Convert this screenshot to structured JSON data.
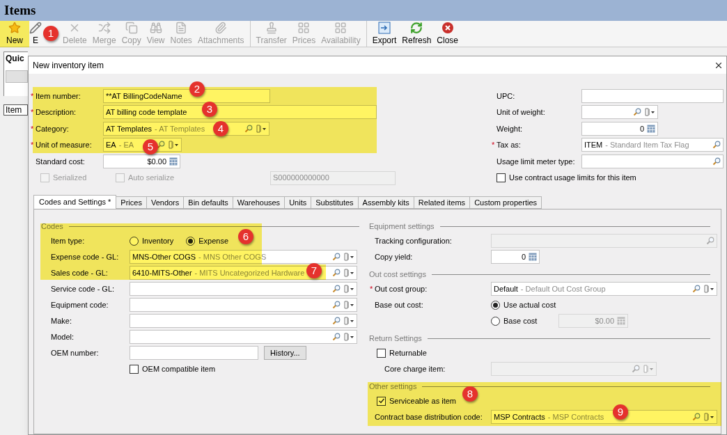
{
  "window": {
    "title": "Items"
  },
  "toolbar_groups": [
    {
      "buttons": [
        {
          "label": "New",
          "disabled": false
        },
        {
          "label": "E",
          "disabled": false
        },
        {
          "label": "Delete",
          "disabled": true
        },
        {
          "label": "Merge",
          "disabled": true
        },
        {
          "label": "Copy",
          "disabled": true
        },
        {
          "label": "View",
          "disabled": true
        },
        {
          "label": "Notes",
          "disabled": true
        },
        {
          "label": "Attachments",
          "disabled": true
        }
      ]
    },
    {
      "buttons": [
        {
          "label": "Transfer",
          "disabled": true
        },
        {
          "label": "Prices",
          "disabled": true
        },
        {
          "label": "Availability",
          "disabled": true
        }
      ]
    },
    {
      "buttons": [
        {
          "label": "Export",
          "disabled": false
        },
        {
          "label": "Refresh",
          "disabled": false
        },
        {
          "label": "Close",
          "disabled": false
        }
      ]
    }
  ],
  "background": {
    "panel_title": "Quic",
    "column_header": "Item"
  },
  "dialog": {
    "title": "New inventory item",
    "general_left": [
      {
        "label": "Item number:",
        "marker": "*",
        "field": {
          "kind": "text",
          "value": "**AT BillingCodeName",
          "disabled": false
        }
      },
      {
        "label": "Description:",
        "marker": "*",
        "field": {
          "kind": "text",
          "value": "AT billing code template",
          "disabled": false
        }
      },
      {
        "label": "Category:",
        "marker": "*",
        "field": {
          "kind": "lookup",
          "value": "AT Templates",
          "description": "- AT Templates",
          "disabled": false
        }
      },
      {
        "label": "Unit of measure:",
        "marker": "*",
        "field": {
          "kind": "lookup",
          "value": "EA",
          "description": "- EA",
          "disabled": false
        }
      },
      {
        "label": "Standard cost:",
        "field": {
          "kind": "number",
          "value": "$0.00",
          "disabled": false
        }
      }
    ],
    "serial_options": [
      {
        "label": "Serialized",
        "checked": false,
        "disabled": true
      },
      {
        "label": "Auto serialize",
        "checked": false,
        "disabled": true
      }
    ],
    "serial_number": {
      "kind": "text",
      "value": "S000000000000",
      "disabled": true
    },
    "general_right": [
      {
        "label": "UPC:",
        "field": {
          "kind": "text",
          "disabled": false
        }
      },
      {
        "label": "Unit of weight:",
        "field": {
          "kind": "lookup",
          "disabled": false
        }
      },
      {
        "label": "Weight:",
        "field": {
          "kind": "number",
          "value": "0",
          "disabled": false
        }
      },
      {
        "label": "Tax as:",
        "marker": "*",
        "field": {
          "kind": "search",
          "value": "ITEM",
          "description": "- Standard Item Tax Flag",
          "disabled": false
        }
      },
      {
        "label": "Usage limit meter type:",
        "field": {
          "kind": "search",
          "disabled": false
        }
      }
    ],
    "usage_limits": {
      "label": "Use contract usage limits for this item",
      "checked": false,
      "disabled": false
    },
    "tabs": [
      {
        "label": "Codes and Settings *",
        "selected": true
      },
      {
        "label": "Prices",
        "selected": false
      },
      {
        "label": "Vendors",
        "selected": false
      },
      {
        "label": "Bin defaults",
        "selected": false
      },
      {
        "label": "Warehouses",
        "selected": false
      },
      {
        "label": "Units",
        "selected": false
      },
      {
        "label": "Substitutes",
        "selected": false
      },
      {
        "label": "Assembly kits",
        "selected": false
      },
      {
        "label": "Related items",
        "selected": false
      },
      {
        "label": "Custom properties",
        "selected": false
      }
    ],
    "codes": {
      "title": "Codes",
      "rows": [
        {
          "kind": "options",
          "label": "Item type:",
          "options": [
            {
              "label": "Inventory",
              "selected": false
            },
            {
              "label": "Expense",
              "selected": true
            }
          ]
        },
        {
          "kind": "field",
          "label": "Expense code - GL:",
          "field": {
            "kind": "lookup",
            "value": "MNS-Other COGS",
            "description": "- MNS Other COGS",
            "disabled": false
          }
        },
        {
          "kind": "field",
          "label": "Sales code - GL:",
          "field": {
            "kind": "lookup",
            "value": "6410-MITS-Other",
            "description": "- MITS Uncategorized Hardware",
            "disabled": false
          }
        },
        {
          "kind": "field",
          "label": "Service code - GL:",
          "field": {
            "kind": "lookup",
            "disabled": false
          }
        },
        {
          "kind": "field",
          "label": "Equipment code:",
          "field": {
            "kind": "lookup",
            "disabled": false
          }
        },
        {
          "kind": "field",
          "label": "Make:",
          "field": {
            "kind": "lookup",
            "disabled": false
          }
        },
        {
          "kind": "field",
          "label": "Model:",
          "field": {
            "kind": "lookup",
            "disabled": false
          }
        },
        {
          "kind": "field_button",
          "label": "OEM number:",
          "field": {
            "kind": "text",
            "disabled": false
          },
          "button": "History..."
        },
        {
          "kind": "checkbox",
          "label": "OEM compatible item",
          "checked": false,
          "disabled": false
        }
      ]
    },
    "settings_groups": [
      {
        "title": "Equipment settings",
        "rows": [
          {
            "kind": "field",
            "label": "Tracking configuration:",
            "field": {
              "kind": "search",
              "disabled": true
            }
          },
          {
            "kind": "field",
            "label": "Copy yield:",
            "field": {
              "kind": "number",
              "value": "0",
              "disabled": false
            }
          }
        ]
      },
      {
        "title": "Out cost settings",
        "rows": [
          {
            "kind": "field",
            "label": "Out cost group:",
            "marker": "*",
            "field": {
              "kind": "lookup",
              "value": "Default",
              "description": "- Default Out Cost Group",
              "disabled": false
            }
          },
          {
            "kind": "radio",
            "label": "Base out cost:",
            "option": {
              "label": "Use actual cost",
              "selected": true
            }
          },
          {
            "kind": "radio",
            "option": {
              "label": "Base cost",
              "selected": false
            },
            "field": {
              "kind": "number",
              "value": "$0.00",
              "disabled": true
            }
          }
        ]
      },
      {
        "title": "Return Settings",
        "rows": [
          {
            "kind": "checkbox",
            "label": "Returnable",
            "checked": false,
            "disabled": false
          },
          {
            "kind": "subfield",
            "label": "Core charge item:",
            "field": {
              "kind": "lookup",
              "disabled": true
            }
          }
        ]
      },
      {
        "title": "Other settings",
        "rows": [
          {
            "kind": "checkbox",
            "label": "Serviceable as item",
            "checked": true,
            "disabled": false
          },
          {
            "kind": "field",
            "label": "Contract base distribution code:",
            "field": {
              "kind": "lookup",
              "value": "MSP Contracts",
              "description": "- MSP Contracts",
              "disabled": false
            }
          }
        ]
      }
    ]
  },
  "callouts": [
    "1",
    "2",
    "3",
    "4",
    "5",
    "6",
    "7",
    "8",
    "9"
  ]
}
